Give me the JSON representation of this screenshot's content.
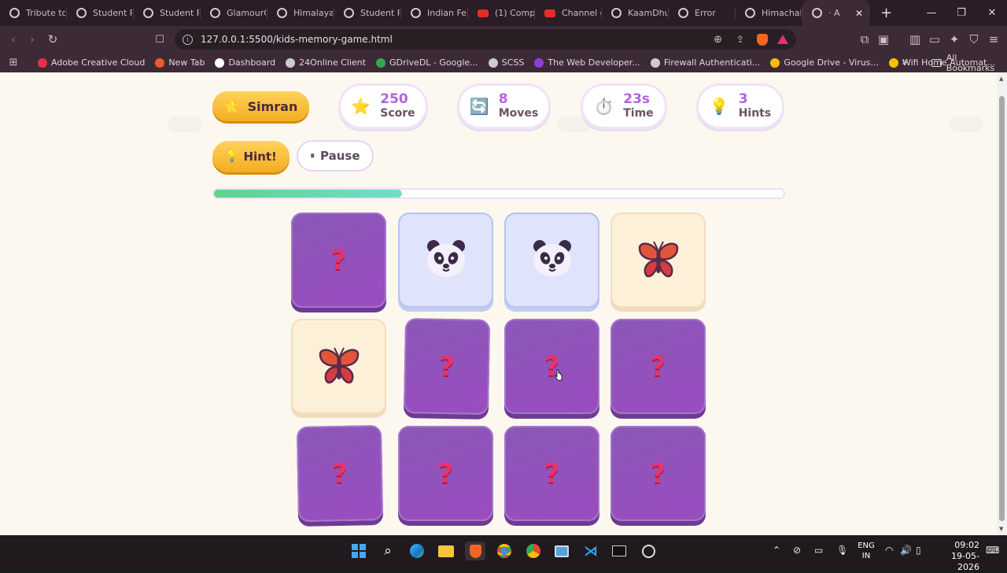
{
  "browser": {
    "tabs": [
      {
        "title": "Tribute to",
        "icon": "globe"
      },
      {
        "title": "Student P",
        "icon": "globe"
      },
      {
        "title": "Student P",
        "icon": "globe"
      },
      {
        "title": "GlamourG",
        "icon": "globe"
      },
      {
        "title": "Himalayan",
        "icon": "globe"
      },
      {
        "title": "Student P",
        "icon": "globe"
      },
      {
        "title": "Indian Fe",
        "icon": "globe"
      },
      {
        "title": "(1) Comp",
        "icon": "youtube"
      },
      {
        "title": "Channel c",
        "icon": "youtube"
      },
      {
        "title": "KaamDhu",
        "icon": "globe"
      },
      {
        "title": "Error",
        "icon": "globe"
      },
      {
        "title": "Himachal",
        "icon": "globe"
      },
      {
        "title": "· A",
        "icon": "globe"
      }
    ],
    "new_tab_label": "+",
    "url": "127.0.0.1:5500/kids-memory-game.html",
    "bookmarks": [
      {
        "label": "Adobe Creative Cloud",
        "color": "#e8304a"
      },
      {
        "label": "New Tab",
        "color": "#f05a24"
      },
      {
        "label": "Dashboard",
        "color": "#ffffff"
      },
      {
        "label": "24Online Client",
        "color": "#cccccc"
      },
      {
        "label": "GDriveDL - Google...",
        "color": "#34a853"
      },
      {
        "label": "SCSS",
        "color": "#cccccc"
      },
      {
        "label": "The Web Developer...",
        "color": "#8c3fd8"
      },
      {
        "label": "Firewall Authenticati...",
        "color": "#cccccc"
      },
      {
        "label": "Google Drive - Virus...",
        "color": "#fbbc04"
      },
      {
        "label": "Wifi Home Automat...",
        "color": "#f2c200"
      }
    ],
    "bookmarks_overflow": "»",
    "all_bookmarks": "All Bookmarks"
  },
  "game": {
    "player_name": "Simran",
    "player_icon": "🌟",
    "stats": [
      {
        "icon": "⭐",
        "value": "250",
        "label": "Score"
      },
      {
        "icon": "🔄",
        "value": "8",
        "label": "Moves"
      },
      {
        "icon": "⏱️",
        "value": "23s",
        "label": "Time"
      },
      {
        "icon": "💡",
        "value": "3",
        "label": "Hints"
      }
    ],
    "hint_button": "Hint!",
    "hint_icon": "💡",
    "pause_button": "Pause",
    "pause_icon": "⏸",
    "progress_fraction": 0.33,
    "hidden_symbol": "?",
    "cards": [
      {
        "state": "hidden"
      },
      {
        "state": "revealed",
        "animal": "panda"
      },
      {
        "state": "revealed",
        "animal": "panda"
      },
      {
        "state": "revealed",
        "animal": "butterfly"
      },
      {
        "state": "revealed",
        "animal": "butterfly"
      },
      {
        "state": "hidden"
      },
      {
        "state": "hidden"
      },
      {
        "state": "hidden"
      },
      {
        "state": "hidden"
      },
      {
        "state": "hidden"
      },
      {
        "state": "hidden"
      },
      {
        "state": "hidden"
      }
    ]
  },
  "taskbar": {
    "language_top": "ENG",
    "language_bottom": "IN",
    "time": "09:02",
    "date": "19-05-2026"
  }
}
